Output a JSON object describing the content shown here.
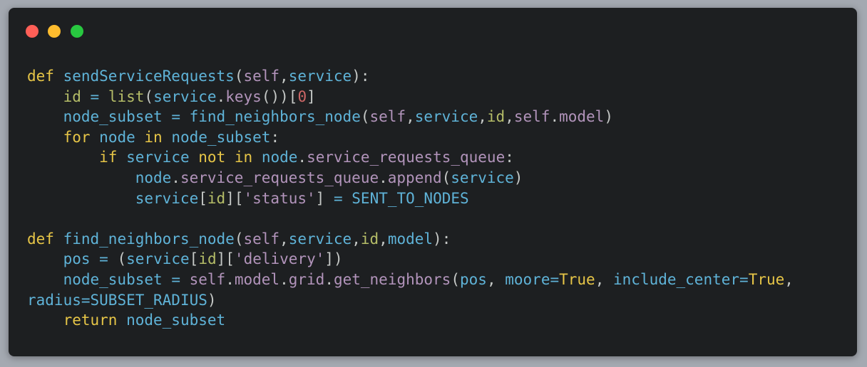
{
  "window": {
    "controls": [
      "close",
      "minimize",
      "maximize"
    ],
    "colors": {
      "close": "#ff5f57",
      "minimize": "#febc2e",
      "maximize": "#28c840",
      "background": "#1d1f21",
      "page_background": "#a4a9b1"
    }
  },
  "code": {
    "language": "python",
    "lines": [
      "def sendServiceRequests(self,service):",
      "    id = list(service.keys())[0]",
      "    node_subset = find_neighbors_node(self,service,id,self.model)",
      "    for node in node_subset:",
      "        if service not in node.service_requests_queue:",
      "            node.service_requests_queue.append(service)",
      "            service[id]['status'] = SENT_TO_NODES",
      "",
      "def find_neighbors_node(self,service,id,model):",
      "    pos = (service[id]['delivery'])",
      "    node_subset = self.model.grid.get_neighbors(pos, moore=True, include_center=True,",
      "radius=SUBSET_RADIUS)",
      "    return node_subset"
    ]
  }
}
